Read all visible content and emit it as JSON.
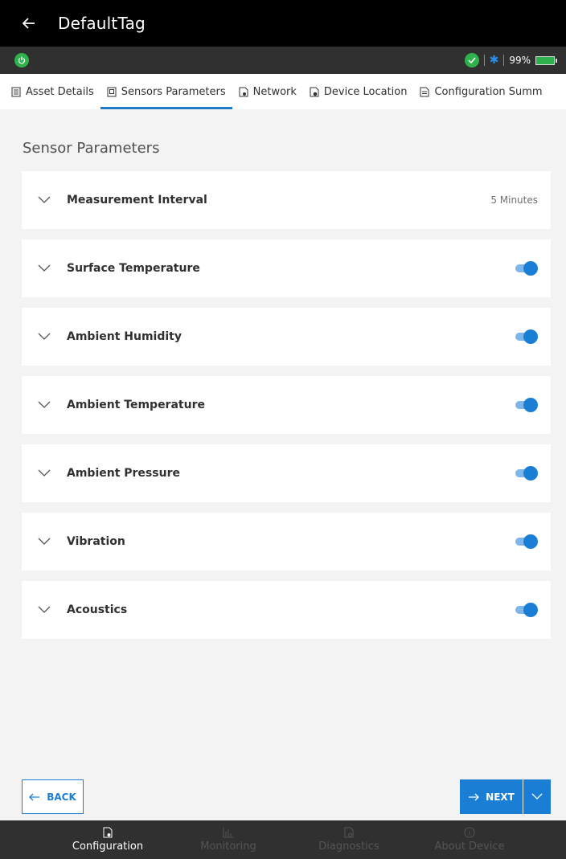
{
  "header": {
    "title": "DefaultTag"
  },
  "status": {
    "battery": "99%"
  },
  "tabs": [
    {
      "label": "Asset Details",
      "icon": "document-icon"
    },
    {
      "label": "Sensors Parameters",
      "icon": "sensor-doc-icon"
    },
    {
      "label": "Network",
      "icon": "network-doc-icon"
    },
    {
      "label": "Device Location",
      "icon": "location-doc-icon"
    },
    {
      "label": "Configuration Summ",
      "icon": "summary-doc-icon"
    }
  ],
  "section": {
    "title": "Sensor Parameters"
  },
  "params": [
    {
      "label": "Measurement Interval",
      "value": "5 Minutes"
    },
    {
      "label": "Surface Temperature",
      "enabled": true
    },
    {
      "label": "Ambient Humidity",
      "enabled": true
    },
    {
      "label": "Ambient Temperature",
      "enabled": true
    },
    {
      "label": "Ambient Pressure",
      "enabled": true
    },
    {
      "label": "Vibration",
      "enabled": true
    },
    {
      "label": "Acoustics",
      "enabled": true
    }
  ],
  "footer": {
    "back_label": "BACK",
    "next_label": "NEXT"
  },
  "nav": [
    {
      "label": "Configuration",
      "active": true
    },
    {
      "label": "Monitoring",
      "active": false
    },
    {
      "label": "Diagnostics",
      "active": false
    },
    {
      "label": "About Device",
      "active": false
    }
  ],
  "colors": {
    "accent": "#1a7fd4",
    "status_ok": "#2fb14b",
    "header_bg": "#000000"
  }
}
